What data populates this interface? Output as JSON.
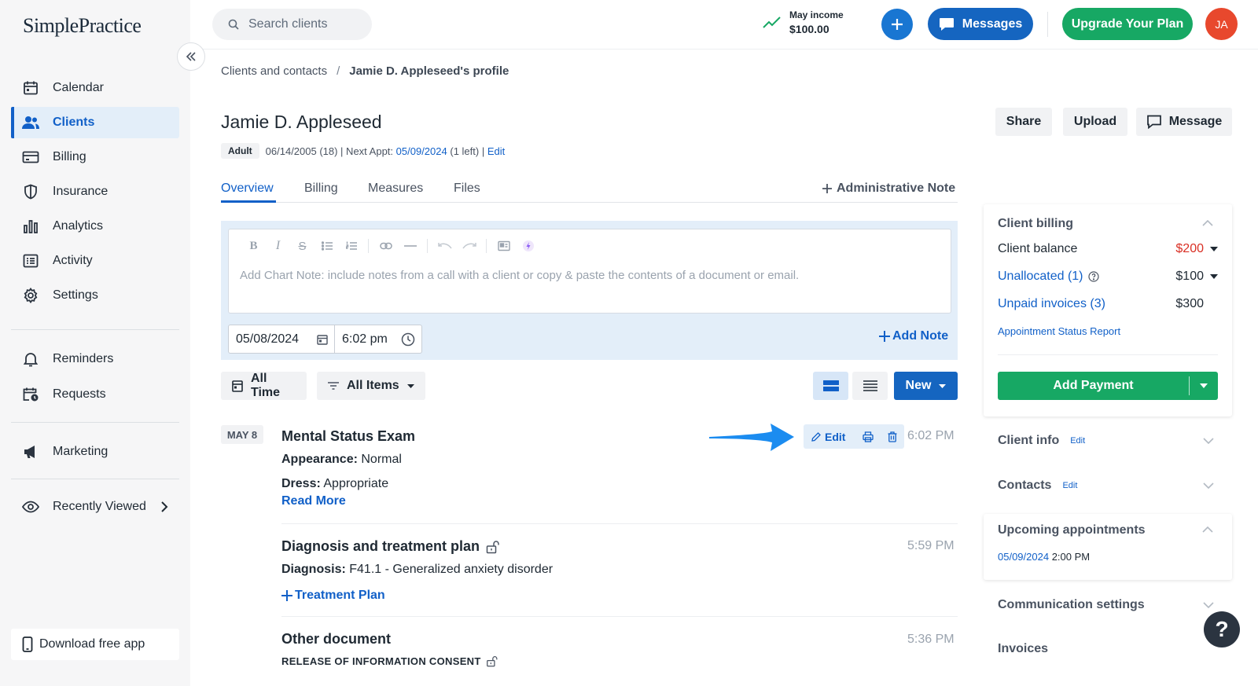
{
  "app": {
    "logo": "SimplePractice"
  },
  "sidebar": {
    "items": [
      {
        "label": "Calendar",
        "icon": "calendar-icon"
      },
      {
        "label": "Clients",
        "icon": "users-icon",
        "active": true
      },
      {
        "label": "Billing",
        "icon": "credit-card-icon"
      },
      {
        "label": "Insurance",
        "icon": "shield-icon"
      },
      {
        "label": "Analytics",
        "icon": "bar-chart-icon"
      },
      {
        "label": "Activity",
        "icon": "list-icon"
      },
      {
        "label": "Settings",
        "icon": "gear-icon"
      },
      {
        "label": "Reminders",
        "icon": "bell-icon"
      },
      {
        "label": "Requests",
        "icon": "calendar-clock-icon"
      },
      {
        "label": "Marketing",
        "icon": "megaphone-icon"
      },
      {
        "label": "Recently Viewed",
        "icon": "eye-icon"
      }
    ],
    "download_label": "Download free app"
  },
  "topbar": {
    "search_placeholder": "Search clients",
    "income_label": "May income",
    "income_value": "$100.00",
    "messages_label": "Messages",
    "upgrade_label": "Upgrade Your Plan",
    "avatar_initials": "JA"
  },
  "breadcrumb": {
    "parent": "Clients and contacts",
    "separator": "/",
    "current": "Jamie D. Appleseed's profile"
  },
  "client": {
    "name": "Jamie D. Appleseed",
    "badge": "Adult",
    "dob": "06/14/2005 (18) | Next Appt:",
    "next_appt": "05/09/2024",
    "left": "(1 left) |",
    "edit": "Edit"
  },
  "header_buttons": {
    "share": "Share",
    "upload": "Upload",
    "message": "Message"
  },
  "tabs": [
    {
      "label": "Overview",
      "active": true
    },
    {
      "label": "Billing"
    },
    {
      "label": "Measures"
    },
    {
      "label": "Files"
    }
  ],
  "admin_note_label": "Administrative Note",
  "editor": {
    "placeholder": "Add Chart Note: include notes from a call with a client or copy & paste the contents of a document or email.",
    "date": "05/08/2024",
    "time": "6:02 pm",
    "add_note_label": "Add Note"
  },
  "filters": {
    "time": "All Time",
    "items": "All Items",
    "new_label": "New"
  },
  "timeline": {
    "date_badge": "MAY 8",
    "entries": [
      {
        "title": "Mental Status Exam",
        "time": "6:02 PM",
        "fields": [
          {
            "label": "Appearance:",
            "value": "Normal"
          },
          {
            "label": "Dress:",
            "value": "Appropriate"
          }
        ],
        "read_more": "Read More",
        "edit_label": "Edit"
      },
      {
        "title": "Diagnosis and treatment plan",
        "time": "5:59 PM",
        "fields": [
          {
            "label": "Diagnosis:",
            "value": "F41.1 - Generalized anxiety disorder"
          }
        ],
        "link": "Treatment Plan"
      },
      {
        "title": "Other document",
        "time": "5:36 PM",
        "subtitle": "RELEASE OF INFORMATION CONSENT"
      }
    ]
  },
  "right_panel": {
    "billing": {
      "title": "Client billing",
      "balance_label": "Client balance",
      "balance_value": "$200",
      "unallocated_label": "Unallocated (1)",
      "unallocated_value": "$100",
      "unpaid_label": "Unpaid invoices (3)",
      "unpaid_value": "$300",
      "report_link": "Appointment Status Report",
      "add_payment": "Add Payment"
    },
    "client_info": {
      "title": "Client info",
      "edit": "Edit"
    },
    "contacts": {
      "title": "Contacts",
      "edit": "Edit"
    },
    "upcoming": {
      "title": "Upcoming appointments",
      "date": "05/09/2024",
      "time": "2:00 PM"
    },
    "communication": {
      "title": "Communication settings"
    },
    "invoices": {
      "title": "Invoices"
    }
  },
  "help_label": "?",
  "colors": {
    "primary": "#1160c8",
    "green": "#17a864",
    "red": "#d93025",
    "sidebar_bg": "#f6f6f7"
  }
}
